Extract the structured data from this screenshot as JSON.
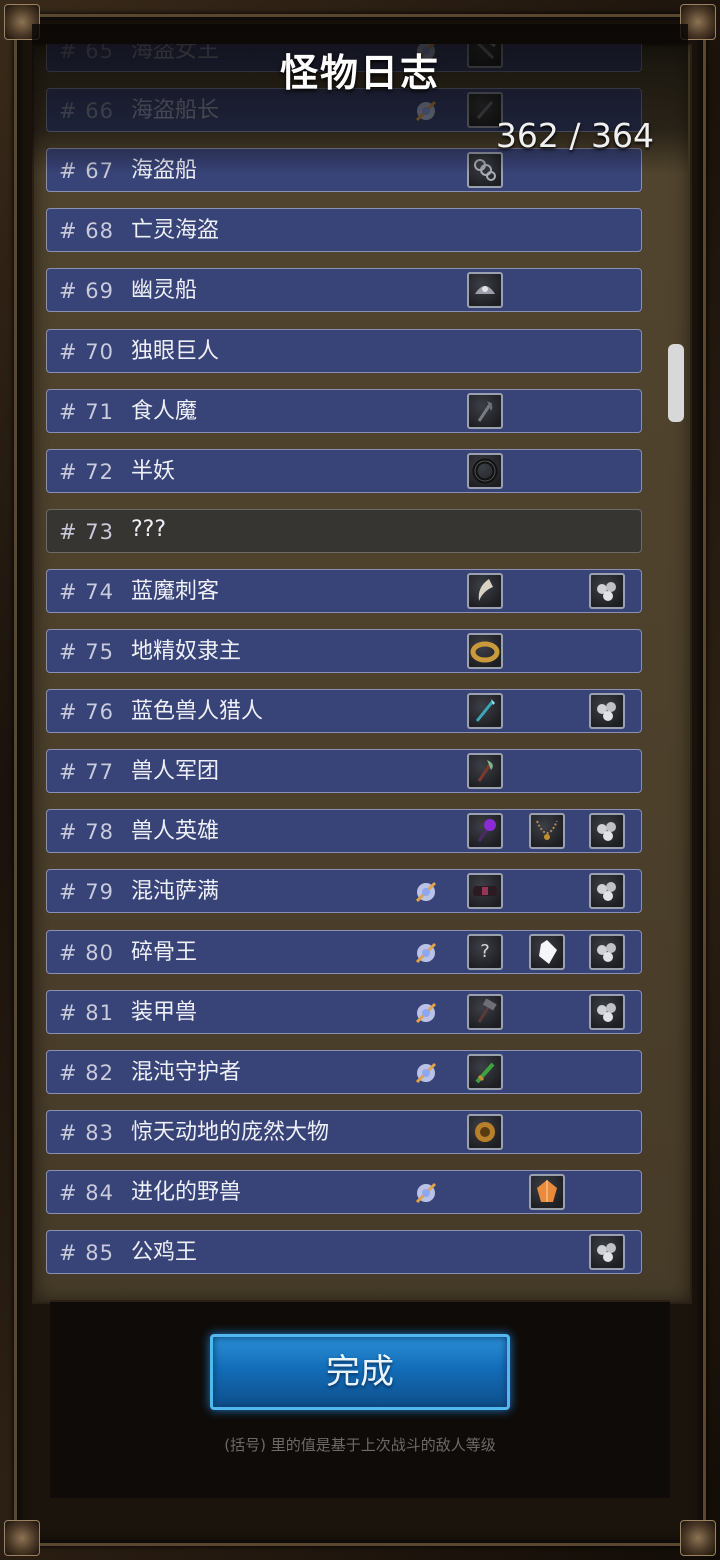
{
  "title": "怪物日志",
  "counter": "362 / 364",
  "done_label": "完成",
  "footnote": "(括号) 里的值是基于上次战斗的敌人等级",
  "colors": {
    "row_bg": "#384377",
    "unknown_bg": "#373531",
    "button": "#1a78c2"
  },
  "entries": [
    {
      "num": "# 65",
      "name": "海盗女王",
      "skill": true,
      "slots": [
        {
          "pos": 1,
          "icon": "pickaxe-icon"
        }
      ],
      "faded": true
    },
    {
      "num": "# 66",
      "name": "海盗船长",
      "skill": true,
      "slots": [
        {
          "pos": 1,
          "icon": "dagger-icon"
        }
      ],
      "faded": true
    },
    {
      "num": "# 67",
      "name": "海盗船",
      "skill": false,
      "slots": [
        {
          "pos": 1,
          "icon": "chain-icon"
        }
      ]
    },
    {
      "num": "# 68",
      "name": "亡灵海盗",
      "skill": false,
      "slots": []
    },
    {
      "num": "# 69",
      "name": "幽灵船",
      "skill": false,
      "slots": [
        {
          "pos": 1,
          "icon": "helmet-icon"
        }
      ]
    },
    {
      "num": "# 70",
      "name": "独眼巨人",
      "skill": false,
      "slots": []
    },
    {
      "num": "# 71",
      "name": "食人魔",
      "skill": false,
      "slots": [
        {
          "pos": 1,
          "icon": "axe-icon"
        }
      ]
    },
    {
      "num": "# 72",
      "name": "半妖",
      "skill": false,
      "slots": [
        {
          "pos": 1,
          "icon": "ring-icon"
        }
      ]
    },
    {
      "num": "# 73",
      "name": "???",
      "skill": false,
      "slots": [],
      "unknown": true
    },
    {
      "num": "# 74",
      "name": "蓝魔刺客",
      "skill": false,
      "slots": [
        {
          "pos": 1,
          "icon": "claw-blade-icon"
        },
        {
          "pos": 3,
          "icon": "loot-bag-icon"
        }
      ]
    },
    {
      "num": "# 75",
      "name": "地精奴隶主",
      "skill": false,
      "slots": [
        {
          "pos": 1,
          "icon": "gold-ring-icon"
        }
      ]
    },
    {
      "num": "# 76",
      "name": "蓝色兽人猎人",
      "skill": false,
      "slots": [
        {
          "pos": 1,
          "icon": "spear-icon"
        },
        {
          "pos": 3,
          "icon": "loot-bag-icon"
        }
      ]
    },
    {
      "num": "# 77",
      "name": "兽人军团",
      "skill": false,
      "slots": [
        {
          "pos": 1,
          "icon": "halberd-icon"
        }
      ]
    },
    {
      "num": "# 78",
      "name": "兽人英雄",
      "skill": false,
      "slots": [
        {
          "pos": 1,
          "icon": "purple-staff-icon"
        },
        {
          "pos": 2,
          "icon": "necklace-icon"
        },
        {
          "pos": 3,
          "icon": "loot-bag-icon"
        }
      ]
    },
    {
      "num": "# 79",
      "name": "混沌萨满",
      "skill": true,
      "slots": [
        {
          "pos": 1,
          "icon": "belt-icon"
        },
        {
          "pos": 3,
          "icon": "loot-bag-icon"
        }
      ]
    },
    {
      "num": "# 80",
      "name": "碎骨王",
      "skill": true,
      "slots": [
        {
          "pos": 1,
          "icon": "question-icon"
        },
        {
          "pos": 2,
          "icon": "crystal-icon"
        },
        {
          "pos": 3,
          "icon": "loot-bag-icon"
        }
      ]
    },
    {
      "num": "# 81",
      "name": "装甲兽",
      "skill": true,
      "slots": [
        {
          "pos": 1,
          "icon": "hammer-icon"
        },
        {
          "pos": 3,
          "icon": "loot-bag-icon"
        }
      ]
    },
    {
      "num": "# 82",
      "name": "混沌守护者",
      "skill": true,
      "slots": [
        {
          "pos": 1,
          "icon": "green-sword-icon"
        }
      ]
    },
    {
      "num": "# 83",
      "name": "惊天动地的庞然大物",
      "skill": false,
      "slots": [
        {
          "pos": 1,
          "icon": "ornate-ring-icon"
        }
      ]
    },
    {
      "num": "# 84",
      "name": "进化的野兽",
      "skill": true,
      "slots": [
        {
          "pos": 2,
          "icon": "amber-gem-icon"
        }
      ]
    },
    {
      "num": "# 85",
      "name": "公鸡王",
      "skill": false,
      "slots": [
        {
          "pos": 3,
          "icon": "loot-bag-icon"
        }
      ]
    }
  ]
}
